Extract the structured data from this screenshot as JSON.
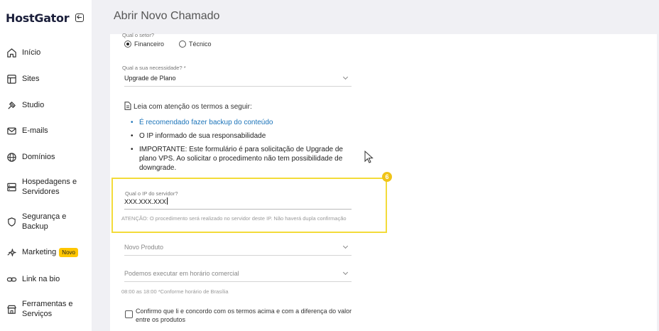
{
  "brand": {
    "name": "HostGator"
  },
  "sidebar": {
    "items": [
      {
        "label": "Início",
        "icon": "home-icon"
      },
      {
        "label": "Sites",
        "icon": "browser-window-icon"
      },
      {
        "label": "Studio",
        "icon": "brush-icon"
      },
      {
        "label": "E-mails",
        "icon": "mail-icon"
      },
      {
        "label": "Domínios",
        "icon": "globe-icon"
      },
      {
        "label": "Hospedagens e Servidores",
        "icon": "server-icon"
      },
      {
        "label": "Segurança e Backup",
        "icon": "shield-icon"
      },
      {
        "label": "Marketing",
        "icon": "sparkle-icon",
        "badge": "Novo"
      },
      {
        "label": "Link na bio",
        "icon": "link-icon"
      },
      {
        "label": "Ferramentas e Serviços",
        "icon": "store-icon"
      }
    ]
  },
  "header": {
    "title": "Abrir Novo Chamado"
  },
  "form": {
    "sector_label": "Qual o setor?",
    "sector_options": [
      "Financeiro",
      "Técnico"
    ],
    "sector_selected": "Financeiro",
    "need_label": "Qual a sua necessidade? *",
    "need_value": "Upgrade de Plano",
    "terms_title": "Leia com atenção os termos a seguir:",
    "terms": [
      "É recomendado fazer backup do conteúdo",
      "O IP informado de sua responsabilidade",
      "IMPORTANTE: Este formulário é para solicitação de Upgrade de plano VPS. Ao solicitar o procedimento não tem possibilidade de downgrade."
    ],
    "step_number": "6",
    "ip_label": "Qual o IP do servidor?",
    "ip_value": "XXX.XXX.XXX",
    "ip_warning": "ATENÇÃO: O procedimento será realizado no servidor deste IP. Não haverá dupla confirmação",
    "product_placeholder": "Novo Produto",
    "schedule_placeholder": "Podemos executar em horário comercial",
    "hours_note": "08:00 as 18:00 *Conforme horário de Brasília",
    "confirm_text": "Confirmo que li e concordo com os termos acima e com a diferença do valor entre os produtos"
  },
  "colors": {
    "link": "#1a73b9",
    "highlight": "#f3db3a",
    "badge": "#ffc600"
  }
}
